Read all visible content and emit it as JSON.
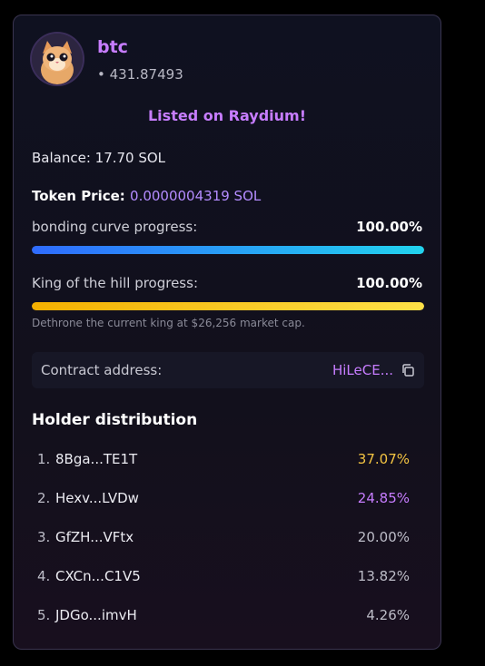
{
  "token": {
    "name": "btc",
    "meta": "• 431.87493",
    "avatar_icon": "cat-avatar-icon"
  },
  "status": {
    "listed_text": "Listed on Raydium!"
  },
  "balance": {
    "text": "Balance: 17.70 SOL"
  },
  "price": {
    "label": "Token Price:",
    "value": "0.0000004319 SOL"
  },
  "bonding_curve": {
    "label": "bonding curve progress:",
    "percent_text": "100.00%",
    "progress": 1.0
  },
  "king_of_hill": {
    "label": "King of the hill progress:",
    "percent_text": "100.00%",
    "progress": 1.0,
    "note": "Dethrone the current king at $26,256 market cap."
  },
  "contract": {
    "label": "Contract address:",
    "address": "HiLeCE...",
    "copy_icon": "copy-icon"
  },
  "holders": {
    "title": "Holder distribution",
    "items": [
      {
        "rank": "1.",
        "address": "8Bga...TE1T",
        "percent": "37.07%",
        "color": "#f5c542"
      },
      {
        "rank": "2.",
        "address": "Hexv...LVDw",
        "percent": "24.85%",
        "color": "#c77dff"
      },
      {
        "rank": "3.",
        "address": "GfZH...VFtx",
        "percent": "20.00%",
        "color": "#bdbdc8"
      },
      {
        "rank": "4.",
        "address": "CXCn...C1V5",
        "percent": "13.82%",
        "color": "#bdbdc8"
      },
      {
        "rank": "5.",
        "address": "JDGo...imvH",
        "percent": "4.26%",
        "color": "#bdbdc8"
      }
    ]
  },
  "colors": {
    "accent_purple": "#c77dff",
    "bonding_bar": "#22d3ee",
    "king_bar": "#fde047"
  }
}
